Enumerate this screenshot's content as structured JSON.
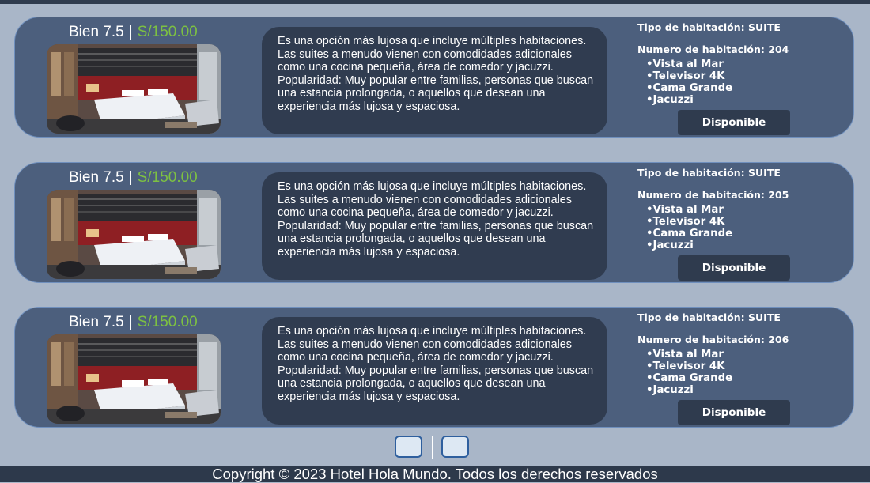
{
  "rooms": [
    {
      "rating": "Bien 7.5",
      "separator": "|",
      "price": "S/150.00",
      "description": "Es una opción más lujosa que incluye múltiples habitaciones. Las suites a menudo vienen con comodidades adicionales como una cocina pequeña, área de comedor y jacuzzi. Popularidad: Muy popular entre familias, personas que buscan una estancia prolongada, o aquellos que desean una experiencia más lujosa y espaciosa.",
      "type_label": "Tipo de habitación: SUITE",
      "number_label": "Numero de habitación: 204",
      "amenities": [
        "Vista al Mar",
        "Televisor 4K",
        "Cama Grande",
        "Jacuzzi"
      ],
      "status": "Disponible"
    },
    {
      "rating": "Bien 7.5",
      "separator": "|",
      "price": "S/150.00",
      "description": "Es una opción más lujosa que incluye múltiples habitaciones. Las suites a menudo vienen con comodidades adicionales como una cocina pequeña, área de comedor y jacuzzi. Popularidad: Muy popular entre familias, personas que buscan una estancia prolongada, o aquellos que desean una experiencia más lujosa y espaciosa.",
      "type_label": "Tipo de habitación: SUITE",
      "number_label": "Numero de habitación: 205",
      "amenities": [
        "Vista al Mar",
        "Televisor 4K",
        "Cama Grande",
        "Jacuzzi"
      ],
      "status": "Disponible"
    },
    {
      "rating": "Bien 7.5",
      "separator": "|",
      "price": "S/150.00",
      "description": "Es una opción más lujosa que incluye múltiples habitaciones. Las suites a menudo vienen con comodidades adicionales como una cocina pequeña, área de comedor y jacuzzi. Popularidad: Muy popular entre familias, personas que buscan una estancia prolongada, o aquellos que desean una experiencia más lujosa y espaciosa.",
      "type_label": "Tipo de habitación: SUITE",
      "number_label": "Numero de habitación: 206",
      "amenities": [
        "Vista al Mar",
        "Televisor 4K",
        "Cama Grande",
        "Jacuzzi"
      ],
      "status": "Disponible"
    }
  ],
  "footer": {
    "text": "Copyright © 2023 Hotel Hola Mundo. Todos los derechos reservados"
  },
  "colors": {
    "page_background": "#a9b6c8",
    "card_background": "#4c5f7d",
    "description_background": "#303c50",
    "price_green": "#7dc142",
    "footer_background": "#2d394b"
  }
}
